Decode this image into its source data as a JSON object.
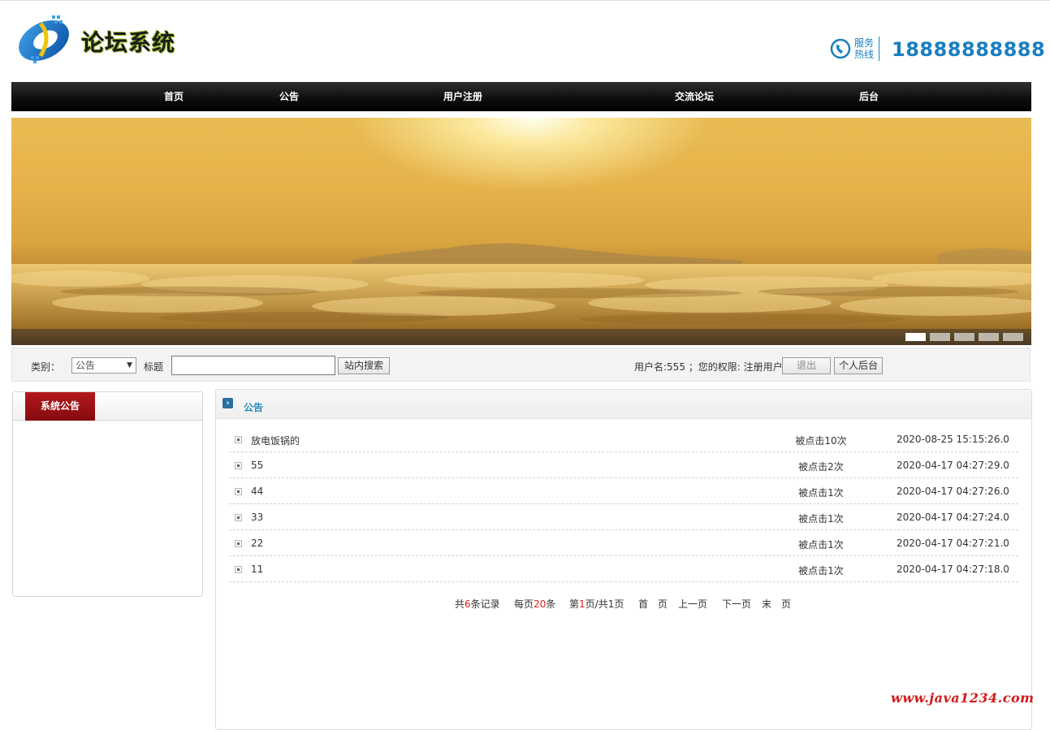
{
  "header": {
    "site_title": "论坛系统",
    "hotline_label": "服务热线",
    "hotline_number": "18888888888"
  },
  "nav": {
    "items": [
      {
        "label": "首页"
      },
      {
        "label": "公告"
      },
      {
        "label": "用户注册"
      },
      {
        "label": "交流论坛"
      },
      {
        "label": "后台"
      }
    ]
  },
  "banner": {
    "slide_count": 5,
    "active_slide": 1
  },
  "search": {
    "category_label": "类别：",
    "category_value": "公告",
    "title_label": "标题",
    "title_value": "",
    "search_button": "站内搜索",
    "user_info": "用户名:555 ；您的权限: 注册用户",
    "logout_button": "退出",
    "backend_button": "个人后台"
  },
  "sidebar": {
    "tab_label": "系统公告"
  },
  "main": {
    "section_title": "公告",
    "rows": [
      {
        "title": "放电饭锅的",
        "clicks": "被点击10次",
        "time": "2020-08-25 15:15:26.0"
      },
      {
        "title": "55",
        "clicks": "被点击2次",
        "time": "2020-04-17 04:27:29.0"
      },
      {
        "title": "44",
        "clicks": "被点击1次",
        "time": "2020-04-17 04:27:26.0"
      },
      {
        "title": "33",
        "clicks": "被点击1次",
        "time": "2020-04-17 04:27:24.0"
      },
      {
        "title": "22",
        "clicks": "被点击1次",
        "time": "2020-04-17 04:27:21.0"
      },
      {
        "title": "11",
        "clicks": "被点击1次",
        "time": "2020-04-17 04:27:18.0"
      }
    ]
  },
  "pager": {
    "total_prefix": "共",
    "total_count": "6",
    "total_suffix": "条记录",
    "per_page_prefix": "每页",
    "per_page_count": "20",
    "per_page_suffix": "条",
    "page_prefix": "第",
    "current_page": "1",
    "page_middle": "页/共",
    "total_pages": "1",
    "page_suffix": "页",
    "first": "首　页",
    "prev": "上一页",
    "next": "下一页",
    "last": "末　页"
  },
  "watermark": "www.java1234.com",
  "colors": {
    "nav_bg": "#000000",
    "accent_blue": "#1a7fc0",
    "tab_red": "#a01215",
    "pager_number": "#dd2222",
    "watermark": "#d21a1a"
  }
}
